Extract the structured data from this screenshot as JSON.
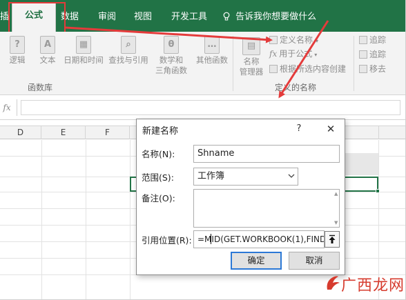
{
  "ribbon": {
    "tabs": [
      {
        "label": "公式",
        "active": true
      },
      {
        "label": "数据"
      },
      {
        "label": "审阅"
      },
      {
        "label": "视图"
      },
      {
        "label": "开发工具"
      }
    ],
    "left_cut_tab": "插",
    "tell_me": "告诉我你想要做什么",
    "function_buttons": [
      {
        "label": "逻辑",
        "icon": "?"
      },
      {
        "label": "文本",
        "icon": "A"
      },
      {
        "label": "日期和时间",
        "icon": "▦"
      },
      {
        "label": "查找与引用",
        "icon": "⌕"
      },
      {
        "label": "数学和",
        "label2": "三角函数",
        "icon": "θ"
      },
      {
        "label": "其他函数",
        "icon": "…"
      }
    ],
    "function_group_label": "函数库",
    "name_manager": {
      "label": "名称",
      "label2": "管理器"
    },
    "define_name": "定义名称",
    "use_in_formula": "用于公式",
    "create_from_selection": "根据所选内容创建",
    "defined_names_group_label": "定义的名称",
    "audit_items": [
      "追踪",
      "追踪",
      "移去"
    ]
  },
  "formula_bar": {
    "fx": "fx",
    "value": ""
  },
  "grid": {
    "columns": [
      "D",
      "E",
      "F"
    ]
  },
  "dialog": {
    "title": "新建名称",
    "help": "?",
    "close": "✕",
    "name_label": "名称(N):",
    "name_value": "Shname",
    "scope_label": "范围(S):",
    "scope_value": "工作簿",
    "comment_label": "备注(O):",
    "comment_value": "",
    "refers_label": "引用位置(R):",
    "refers_value_prefix": "=M",
    "refers_value_suffix": "ID(GET.WORKBOOK(1),FIND",
    "ok_label": "确定",
    "cancel_label": "取消"
  },
  "watermark": {
    "text": "广西龙网"
  },
  "colors": {
    "excel_green": "#217346",
    "annotation_red": "#e43b3b",
    "ok_border": "#2b78d6"
  }
}
